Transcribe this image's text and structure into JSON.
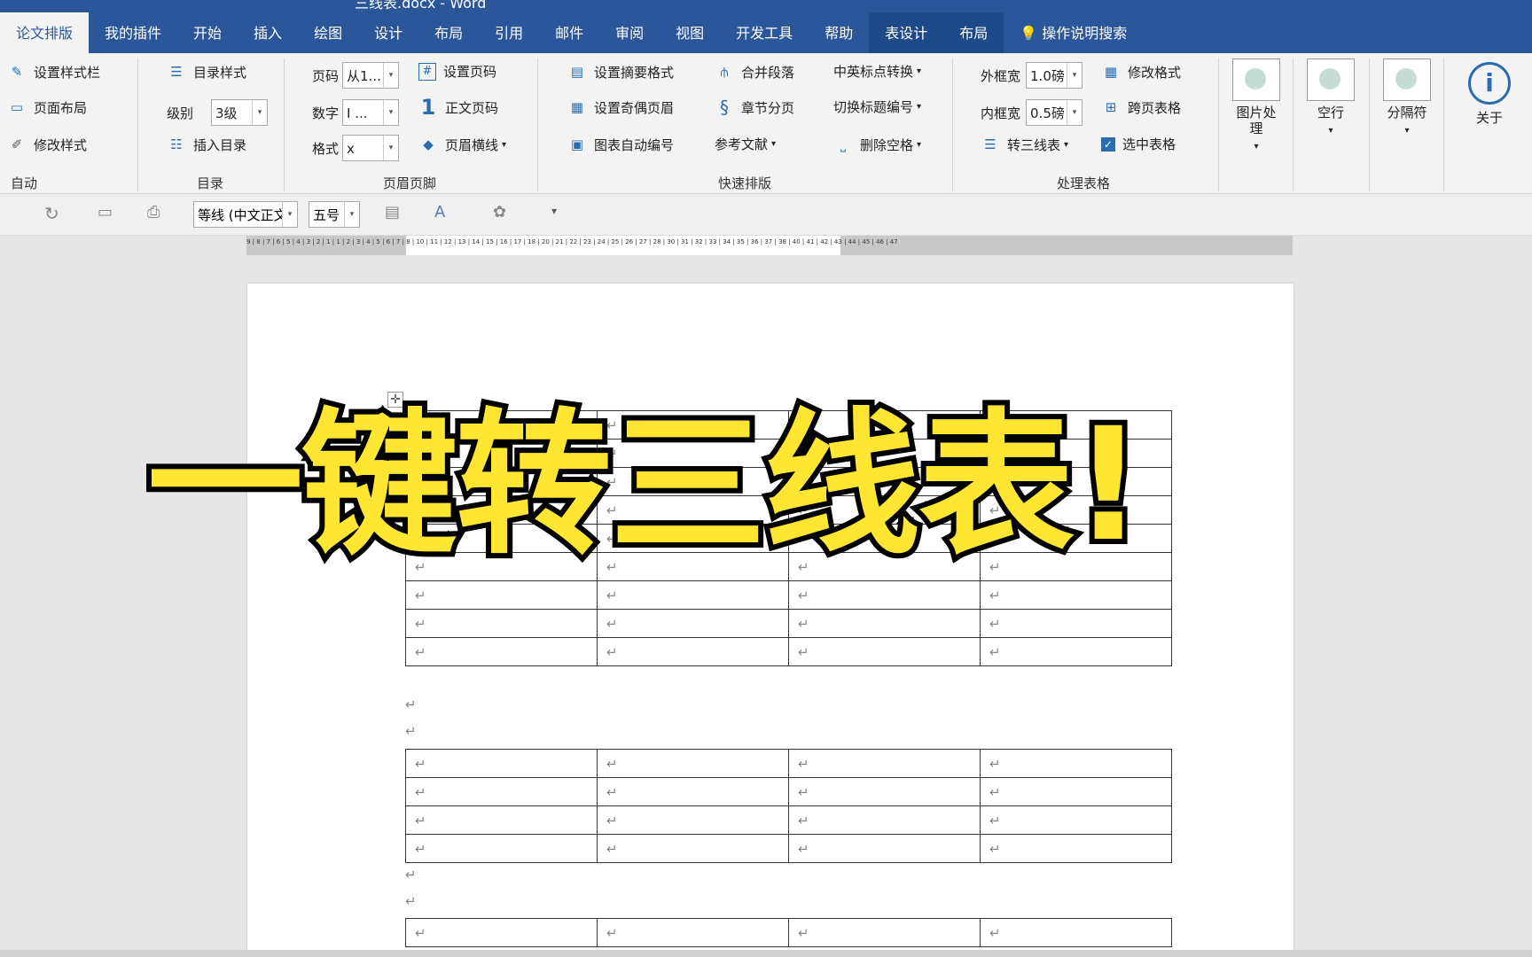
{
  "title": {
    "text": "三线表.docx - Word"
  },
  "tabs": [
    "论文排版",
    "我的插件",
    "开始",
    "插入",
    "绘图",
    "设计",
    "布局",
    "引用",
    "邮件",
    "审阅",
    "视图",
    "开发工具",
    "帮助",
    "表设计",
    "布局"
  ],
  "search": {
    "label": "操作说明搜索"
  },
  "ribbon": {
    "auto": {
      "set_style_bar": "设置样式栏",
      "page_layout": "页面布局",
      "modify_style": "修改样式",
      "group": "自动"
    },
    "toc": {
      "toc_style": "目录样式",
      "level_label": "级别",
      "level_value": "3级",
      "insert_toc": "插入目录",
      "group": "目录"
    },
    "header_footer": {
      "page_num_label": "页码",
      "page_num_value": "从1...",
      "number_label": "数字",
      "number_value": "I ...",
      "format_label": "格式",
      "format_value": "x",
      "set_page_num": "设置页码",
      "body_page_num": "正文页码",
      "header_line": "页眉横线",
      "group": "页眉页脚"
    },
    "quick": {
      "abstract_format": "设置摘要格式",
      "odd_even_header": "设置奇偶页眉",
      "auto_number": "图表自动编号",
      "merge_para": "合并段落",
      "chapter_break": "章节分页",
      "references": "参考文献",
      "punct_convert": "中英标点转换",
      "switch_heading": "切换标题编号",
      "delete_space": "删除空格",
      "group": "快速排版"
    },
    "table": {
      "outer_label": "外框宽",
      "outer_value": "1.0磅",
      "inner_label": "内框宽",
      "inner_value": "0.5磅",
      "three_line": "转三线表",
      "modify_format": "修改格式",
      "cross_page": "跨页表格",
      "select_table": "选中表格",
      "group": "处理表格"
    },
    "big": {
      "image": "图片处理",
      "blank": "空行",
      "separator": "分隔符",
      "about": "关于"
    }
  },
  "qat": {
    "font": "等线 (中文正文)",
    "size": "五号"
  },
  "ruler": {
    "label": "9 | 8 | 7 | 6 | 5 | 4 | 3 | 2 | 1 | 1 | 2 | 3 | 4 | 5 | 6 | 7 | 8 | 10 | 11 | 12 | 13 | 14 | 15 | 16 | 17 | 18 | 20 | 21 | 22 | 23 | 24 | 25 | 26 | 27 | 28 | 30 | 31 | 32 | 33 | 34 | 35 | 36 | 37 | 38 | 40 | 41 | 42 | 43 | 44 | 45 | 46 | 47"
  },
  "doc": {
    "mark": "↵"
  },
  "overlay": {
    "text": "一键转三线表!"
  }
}
